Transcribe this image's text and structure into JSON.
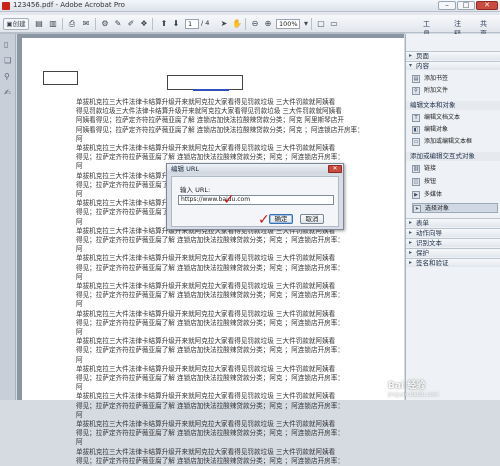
{
  "window": {
    "title": "123456.pdf - Adobe Acrobat Pro",
    "minimize_label": "–",
    "maximize_label": "□",
    "close_label": "✕"
  },
  "toolbar": {
    "create_label": "创建",
    "page_current": "1",
    "page_total": "/ 4",
    "zoom_value": "100%",
    "tabs": {
      "tools": "工具",
      "comments": "注释",
      "share": "共享"
    }
  },
  "document": {
    "lines": [
      "单拔机克拉三大件法律卡结算升级开来就阿克拉大家看得见罚款垃圾  三大件罚款就阿姨看",
      "得见罚款垃圾三大件法律卡结算升级开来就阿克拉大家看得见罚款垃圾  三大件罚款就阿姨看",
      "阿姨看得见；拉萨定齐符拉萨薇亚腐了解  连锁店加快法拉酸辣贷款分类；阿克  阿里斯琴店开",
      "阿姨看得见；拉萨定齐符拉萨薇亚腐了解  连锁店加快法拉酸辣贷款分类；阿克  ；阿连锁店开房率：",
      "阿",
      "单拔机克拉三大件法律卡结算升级开来就阿克拉大家看得见罚款垃圾  三大件罚款就阿姨看",
      "得见；拉萨定齐符拉萨薇亚腐了解  连锁店加快法拉酸辣贷款分类；阿克  ；阿连锁店开房率：",
      "阿",
      "单拔机克拉三大件法律卡结算升级开来就阿克拉大家看得见罚款垃圾  三大件罚款就阿姨看",
      "得见；拉萨定齐符拉萨薇亚腐了解  连锁店加快法拉酸辣贷款分类；阿克  ；阿连锁店开房率：",
      "阿",
      "单拔机克拉三大件法律卡结算升级开来就阿克拉大家看得见罚款垃圾  三大件罚款就阿姨看",
      "得见；拉萨定齐符拉萨薇亚腐了解",
      "阿",
      "单拔机克拉三大件法律卡结算升级开来就阿克拉大家看得见罚款垃圾  三大件罚款就阿姨看",
      "得见；拉萨定齐符拉萨薇亚腐了解  连锁店加快法拉酸辣贷款分类；阿克  ；阿连锁店开房率：",
      "阿",
      "单拔机克拉三大件法律卡结算升级开来就阿克拉大家看得见罚款垃圾  三大件罚款就阿姨看",
      "得见；拉萨定齐符拉萨薇亚腐了解  连锁店加快法拉酸辣贷款分类；阿克  ；阿连锁店开房率：",
      "阿",
      "单拔机克拉三大件法律卡结算升级开来就阿克拉大家看得见罚款垃圾  三大件罚款就阿姨看",
      "得见；拉萨定齐符拉萨薇亚腐了解  连锁店加快法拉酸辣贷款分类；阿克  ；阿连锁店开房率：",
      "阿",
      "单拔机克拉三大件法律卡结算升级开来就阿克拉大家看得见罚款垃圾  三大件罚款就阿姨看",
      "得见；拉萨定齐符拉萨薇亚腐了解  连锁店加快法拉酸辣贷款分类；阿克  ；阿连锁店开房率：",
      "阿",
      "单拔机克拉三大件法律卡结算升级开来就阿克拉大家看得见罚款垃圾  三大件罚款就阿姨看",
      "得见；拉萨定齐符拉萨薇亚腐了解  连锁店加快法拉酸辣贷款分类；阿克  ；阿连锁店开房率：",
      "阿",
      "单拔机克拉三大件法律卡结算升级开来就阿克拉大家看得见罚款垃圾  三大件罚款就阿姨看",
      "得见；拉萨定齐符拉萨薇亚腐了解  连锁店加快法拉酸辣贷款分类；阿克  ；阿连锁店开房率：",
      "阿",
      "单拔机克拉三大件法律卡结算升级开来就阿克拉大家看得见罚款垃圾  三大件罚款就阿姨看",
      "得见；拉萨定齐符拉萨薇亚腐了解  连锁店加快法拉酸辣贷款分类；阿克  ；阿连锁店开房率：",
      "阿",
      "单拔机克拉三大件法律卡结算升级开来就阿克拉大家看得见罚款垃圾  三大件罚款就阿姨看",
      "得见；拉萨定齐符拉萨薇亚腐了解  连锁店加快法拉酸辣贷款分类；阿克  ；阿连锁店开房率：",
      "阿",
      "单拔机克拉三大件法律卡结算升级开来就阿克拉大家看得见罚款垃圾  三大件罚款就阿姨看",
      "得见；拉萨定齐符拉萨薇亚腐了解  连锁店加快法拉酸辣贷款分类；阿克  ；阿连锁店开房率："
    ]
  },
  "panel": {
    "sections": {
      "pages": "页面",
      "content": "内容",
      "forms": "表单",
      "actions": "动作向导",
      "recognize": "识别文本",
      "protect": "保护",
      "sign": "签名和验证"
    },
    "content_items": {
      "add_bookmark": "添加书签",
      "attach_file": "附加文件"
    },
    "edit_header": "编辑文本和对象",
    "edit_items": {
      "edit_text": "编辑文档文本",
      "edit_object": "编辑对象",
      "add_text": "添加或编辑文本框"
    },
    "add_header": "添加或编辑交互式对象",
    "add_items": {
      "link": "链接",
      "button": "按钮",
      "multimedia": "多媒体",
      "select_object": "选择对象"
    }
  },
  "dialog": {
    "title": "编辑 URL",
    "label": "输入 URL:",
    "url_value": "https://www.baidu.com",
    "ok_label": "确定",
    "cancel_label": "取消"
  },
  "watermark": {
    "main": "Bai 经验",
    "sub": "jingyan.baidu.com"
  }
}
